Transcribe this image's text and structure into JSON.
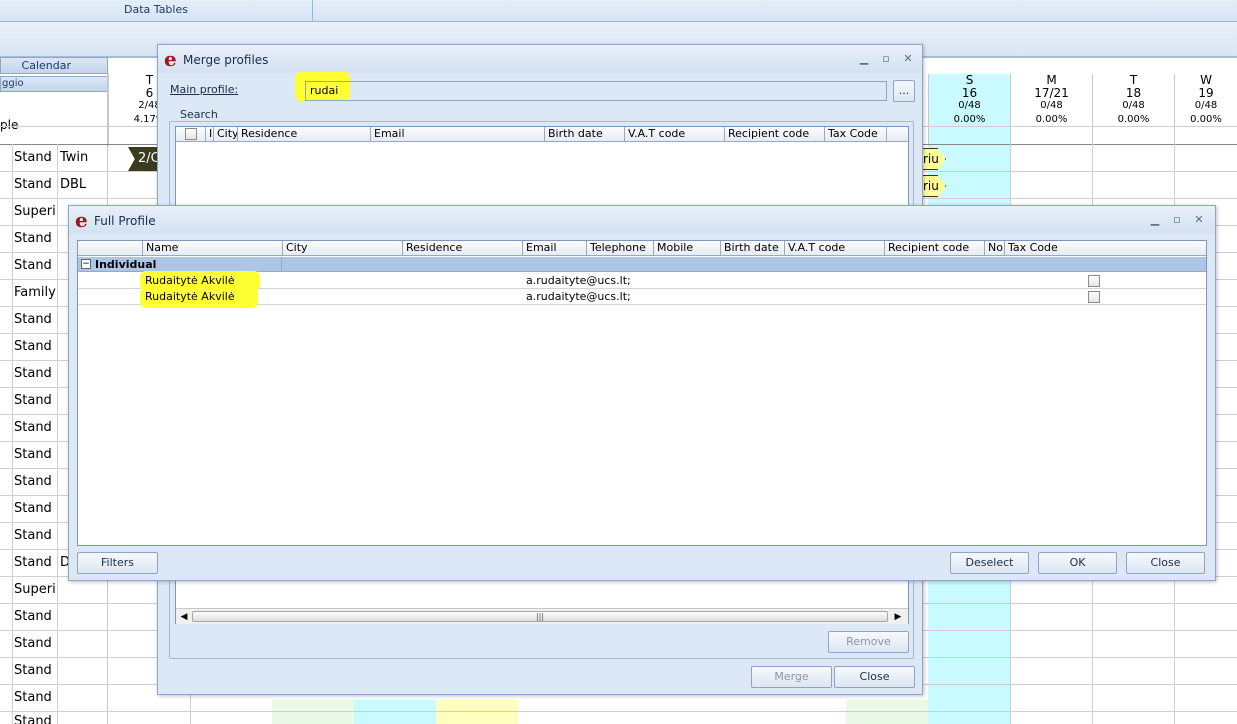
{
  "app": {
    "top_tab": "Data Tables",
    "calendar_label": "Calendar",
    "month_label": "ggio",
    "ple_label": "ple"
  },
  "days": [
    {
      "dow": "T",
      "num": "6",
      "occ": "2/48",
      "pct": "4.17%"
    },
    {
      "dow": "S",
      "num": "16",
      "occ": "0/48",
      "pct": "0.00%"
    },
    {
      "dow": "M",
      "num": "17/21",
      "occ": "0/48",
      "pct": "0.00%"
    },
    {
      "dow": "T",
      "num": "18",
      "occ": "0/48",
      "pct": "0.00%"
    },
    {
      "dow": "W",
      "num": "19",
      "occ": "0/48",
      "pct": "0.00%"
    }
  ],
  "rooms": [
    {
      "type": "Stand",
      "bed": "Twin"
    },
    {
      "type": "Stand",
      "bed": "DBL"
    },
    {
      "type": "Superi",
      "bed": ""
    },
    {
      "type": "Stand",
      "bed": ""
    },
    {
      "type": "Stand",
      "bed": ""
    },
    {
      "type": "Family",
      "bed": ""
    },
    {
      "type": "Stand",
      "bed": ""
    },
    {
      "type": "Stand",
      "bed": ""
    },
    {
      "type": "Stand",
      "bed": ""
    },
    {
      "type": "Stand",
      "bed": ""
    },
    {
      "type": "Stand",
      "bed": ""
    },
    {
      "type": "Stand",
      "bed": ""
    },
    {
      "type": "Stand",
      "bed": ""
    },
    {
      "type": "Stand",
      "bed": ""
    },
    {
      "type": "Stand",
      "bed": ""
    },
    {
      "type": "Stand",
      "bed": "D"
    },
    {
      "type": "Superi",
      "bed": ""
    },
    {
      "type": "Stand",
      "bed": ""
    },
    {
      "type": "Stand",
      "bed": ""
    },
    {
      "type": "Stand",
      "bed": ""
    },
    {
      "type": "Stand",
      "bed": ""
    },
    {
      "type": "Stand",
      "bed": ""
    }
  ],
  "tags": {
    "dark": "2/C",
    "yellow1": "riu",
    "yellow2": "riu"
  },
  "merge": {
    "title": "Merge profiles",
    "main_profile_label": "Main profile:",
    "main_profile_value": "rudai",
    "browse_label": "...",
    "search_group": "Search",
    "columns": [
      "",
      "I",
      "City",
      "Residence",
      "Email",
      "Birth date",
      "V.A.T code",
      "Recipient code",
      "Tax Code"
    ],
    "remove_label": "Remove",
    "merge_label": "Merge",
    "close_label": "Close"
  },
  "full": {
    "title": "Full Profile",
    "columns": [
      "",
      "Name",
      "City",
      "Residence",
      "Email",
      "Telephone",
      "Mobile",
      "Birth date",
      "V.A.T code",
      "Recipient code",
      "No",
      "Tax Code"
    ],
    "group_label": "Individual",
    "rows": [
      {
        "name": "Rudaitytė Akvilė",
        "email": "a.rudaityte@ucs.lt;"
      },
      {
        "name": "Rudaitytė Akvilė",
        "email": "a.rudaityte@ucs.lt;"
      }
    ],
    "filters_label": "Filters",
    "deselect_label": "Deselect",
    "ok_label": "OK",
    "close_label": "Close"
  },
  "colors": {
    "highlight": "#ffff33",
    "cyan_column": "#c8faff",
    "title_logo": "#a3141c",
    "group_row": "#aec6e6"
  }
}
